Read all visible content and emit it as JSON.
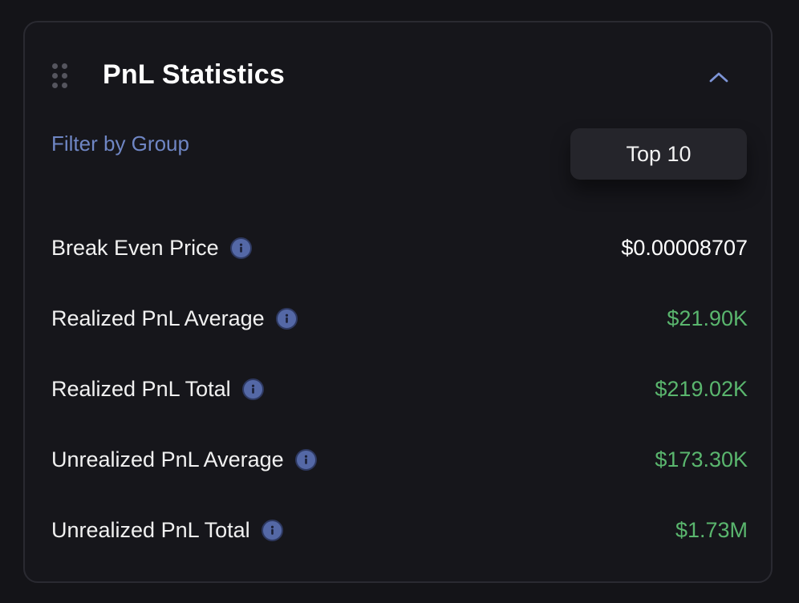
{
  "panel": {
    "title": "PnL Statistics",
    "filter_label": "Filter by Group",
    "filter_selected": "Top 10"
  },
  "stats": [
    {
      "label": "Break Even Price",
      "value": "$0.00008707",
      "tone": "neutral"
    },
    {
      "label": "Realized PnL Average",
      "value": "$21.90K",
      "tone": "positive"
    },
    {
      "label": "Realized PnL Total",
      "value": "$219.02K",
      "tone": "positive"
    },
    {
      "label": "Unrealized PnL Average",
      "value": "$173.30K",
      "tone": "positive"
    },
    {
      "label": "Unrealized PnL Total",
      "value": "$1.73M",
      "tone": "positive"
    }
  ],
  "colors": {
    "background": "#141418",
    "card": "#16161b",
    "accent_label": "#6f86c4",
    "positive": "#5ab66e",
    "info_icon": "#5468a6"
  },
  "icons": {
    "drag": "drag-handle-icon",
    "collapse": "chevron-up-icon",
    "info": "info-icon"
  }
}
